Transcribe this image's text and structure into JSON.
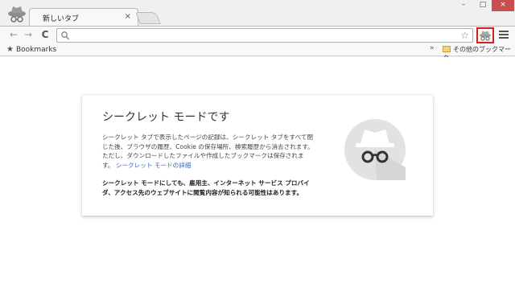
{
  "tab": {
    "title": "新しいタブ",
    "close": "×"
  },
  "window_controls": {
    "minimize": "–",
    "maximize": "□",
    "close": "×"
  },
  "toolbar": {
    "back": "←",
    "forward": "→",
    "reload": "C",
    "star": "☆"
  },
  "omnibox": {
    "value": "",
    "placeholder": ""
  },
  "bookmarks": {
    "label": "Bookmarks",
    "chevron": "»",
    "other": "その他のブックマーク"
  },
  "card": {
    "title": "シークレット モードです",
    "para_line1": "シークレット タブで表示したページの記録は、シークレット タブをすべて閉",
    "para_line2": "じた後、ブラウザの履歴、Cookie の保存場所、検索履歴から消去されます。",
    "para_line3": "ただし、ダウンロードしたファイルや作成したブックマークは保存されま",
    "para_line4": "す。",
    "link": "シークレット モードの詳細",
    "bold_line1": "シークレット モードにしても、雇用主、インターネット サービス プロバイ",
    "bold_line2": "ダ、アクセス先のウェブサイトに閲覧内容が知られる可能性はあります。"
  },
  "colors": {
    "accent_link": "#3367d6",
    "highlight_border": "#d62020"
  },
  "icons": [
    "incognito-icon",
    "back-arrow-icon",
    "forward-arrow-icon",
    "reload-icon",
    "search-icon",
    "star-icon",
    "menu-icon",
    "folder-icon"
  ]
}
